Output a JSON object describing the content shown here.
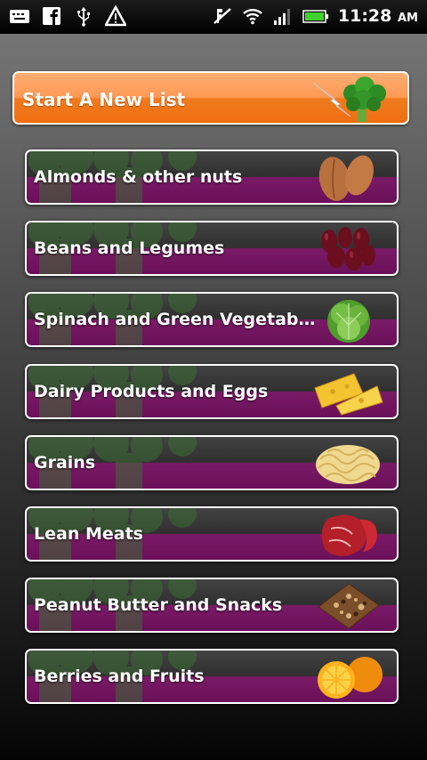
{
  "status_bar": {
    "icons_left": [
      "keyboard-icon",
      "facebook-icon",
      "usb-icon",
      "warning-icon"
    ],
    "icons_right": [
      "silent-icon",
      "wifi-icon",
      "signal-icon",
      "battery-icon"
    ],
    "time": "11:28",
    "ampm": "AM"
  },
  "start_button": {
    "label": "Start A New List",
    "icon": "broccoli-icon"
  },
  "categories": [
    {
      "label": "Almonds & other nuts",
      "icon": "almonds-icon"
    },
    {
      "label": "Beans and Legumes",
      "icon": "beans-icon"
    },
    {
      "label": "Spinach and Green Vegetab…",
      "icon": "lettuce-icon"
    },
    {
      "label": "Dairy Products and Eggs",
      "icon": "cheese-icon"
    },
    {
      "label": "Grains",
      "icon": "pasta-icon"
    },
    {
      "label": "Lean Meats",
      "icon": "steak-icon"
    },
    {
      "label": "Peanut Butter and Snacks",
      "icon": "granola-bar-icon"
    },
    {
      "label": "Berries and Fruits",
      "icon": "orange-icon"
    }
  ],
  "colors": {
    "orange": "#f07a1e",
    "purple": "#6a1059",
    "dark": "#2f2f2f"
  }
}
